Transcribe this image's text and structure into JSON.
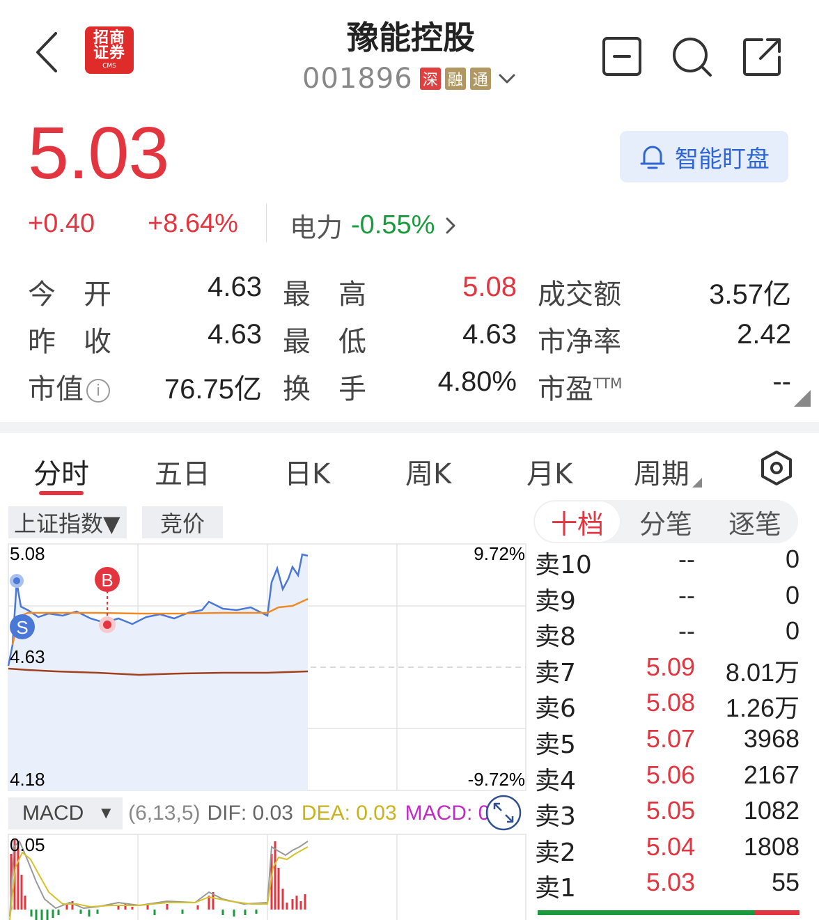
{
  "header": {
    "title": "豫能控股",
    "code": "001896",
    "badges": [
      "深",
      "融",
      "通"
    ],
    "broker_logo": {
      "line1": "招商",
      "line2": "证券",
      "line3": "CMS"
    }
  },
  "quote": {
    "price": "5.03",
    "change": "+0.40",
    "change_pct": "+8.64%",
    "sector_name": "电力",
    "sector_pct": "-0.55%",
    "monitor_label": "智能盯盘"
  },
  "stats": {
    "open_label": "今　开",
    "open": "4.63",
    "high_label": "最　高",
    "high": "5.08",
    "amount_label": "成交额",
    "amount": "3.57亿",
    "prev_label": "昨　收",
    "prev": "4.63",
    "low_label": "最　低",
    "low": "4.63",
    "pb_label": "市净率",
    "pb": "2.42",
    "mcap_label": "市值",
    "mcap": "76.75亿",
    "turnover_label": "换　手",
    "turnover": "4.80%",
    "pe_label": "市盈",
    "pe_sup": "TTM",
    "pe": "--"
  },
  "tabs": [
    "分时",
    "五日",
    "日K",
    "周K",
    "月K",
    "周期"
  ],
  "chart": {
    "index_selector": "上证指数▼",
    "auction_label": "竞价",
    "y_top": "5.08",
    "y_mid": "4.63",
    "y_bot": "4.18",
    "pct_top": "9.72%",
    "pct_bot": "-9.72%",
    "marker_b": "B",
    "marker_s": "S",
    "macd_name": "MACD",
    "macd_params": "(6,13,5)",
    "dif": "DIF: 0.03",
    "dea": "DEA: 0.03",
    "macd_val": "MACD: 0",
    "macd_y": "0.05"
  },
  "orderbook": {
    "tabs": [
      "十档",
      "分笔",
      "逐笔"
    ],
    "rows": [
      {
        "label": "卖10",
        "price": "--",
        "vol": "0"
      },
      {
        "label": "卖9",
        "price": "--",
        "vol": "0"
      },
      {
        "label": "卖8",
        "price": "--",
        "vol": "0"
      },
      {
        "label": "卖7",
        "price": "5.09",
        "vol": "8.01万"
      },
      {
        "label": "卖6",
        "price": "5.08",
        "vol": "1.26万"
      },
      {
        "label": "卖5",
        "price": "5.07",
        "vol": "3968"
      },
      {
        "label": "卖4",
        "price": "5.06",
        "vol": "2167"
      },
      {
        "label": "卖3",
        "price": "5.05",
        "vol": "1082"
      },
      {
        "label": "卖2",
        "price": "5.04",
        "vol": "1808"
      },
      {
        "label": "卖1",
        "price": "5.03",
        "vol": "55"
      }
    ]
  },
  "colors": {
    "up": "#e3353f",
    "down": "#1a9a3d",
    "price_line": "#4a78d6",
    "avg_line": "#f08a24",
    "index_line": "#a0401c"
  }
}
